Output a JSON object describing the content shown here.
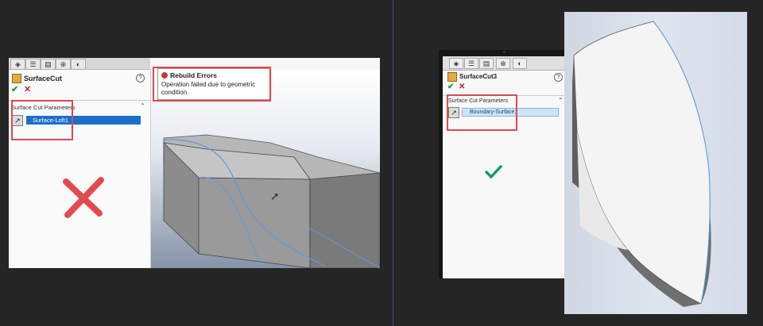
{
  "left": {
    "feature_name": "SurfaceCut",
    "group_title": "Surface Cut Parameters",
    "selection": "Surface-Loft1",
    "ok": "✔",
    "cancel": "✕",
    "help": "?",
    "error_title": "Rebuild Errors",
    "error_message": "Operation failed due to geometric condition.",
    "status_mark": "✕"
  },
  "right": {
    "feature_name": "SurfaceCut3",
    "group_title": "Surface Cut Parameters",
    "selection": "Boundary-Surface1",
    "ok": "✔",
    "cancel": "✕",
    "help": "?",
    "status_mark": "✔"
  },
  "colors": {
    "highlight": "#e0494f",
    "fail_mark": "#e24a4f",
    "success_mark": "#1a9a74",
    "selection_blue": "#1b6fc9"
  }
}
